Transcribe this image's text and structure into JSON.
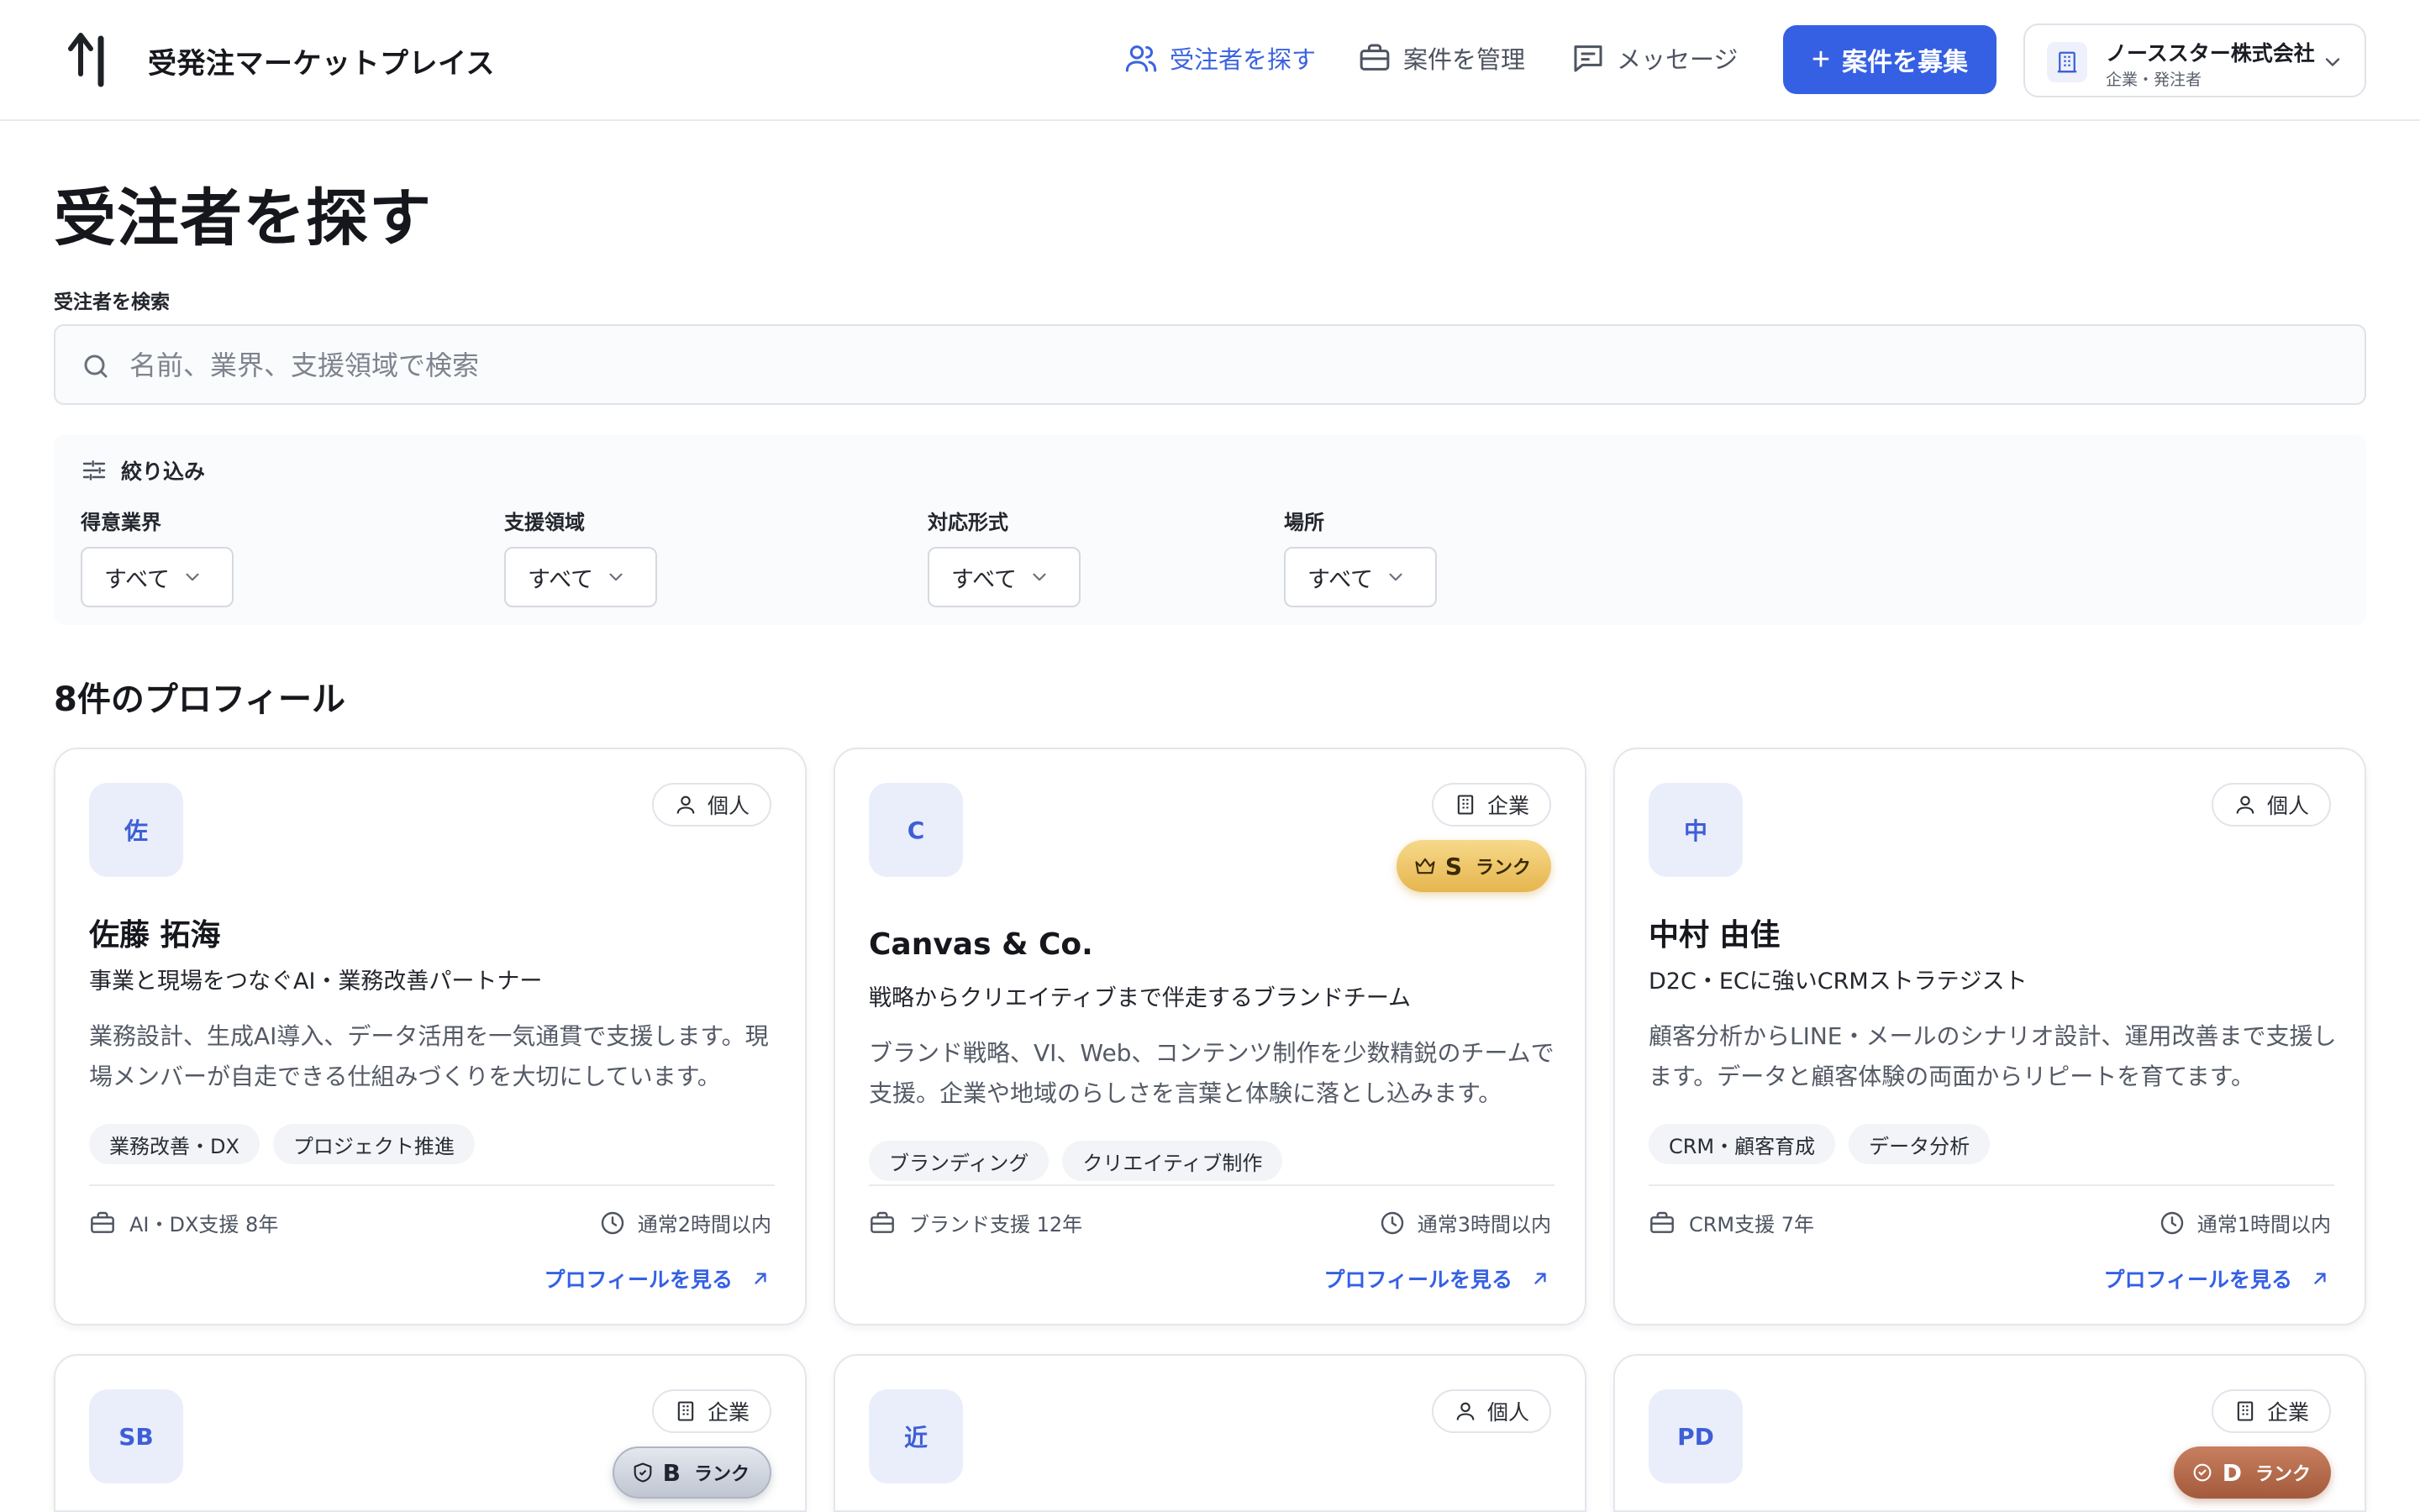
{
  "app": {
    "brand": "受発注マーケットプレイス",
    "logo_icon": "arrow-logo-icon"
  },
  "nav": [
    {
      "label": "受注者を探す",
      "icon": "users-icon",
      "active": true
    },
    {
      "label": "案件を管理",
      "icon": "briefcase-icon",
      "active": false
    },
    {
      "label": "メッセージ",
      "icon": "message-icon",
      "active": false
    }
  ],
  "cta": {
    "label": "案件を募集"
  },
  "account": {
    "name": "ノーススター株式会社",
    "role": "企業・発注者"
  },
  "page": {
    "title": "受注者を探す"
  },
  "search": {
    "label": "受注者を検索",
    "placeholder": "名前、業界、支援領域で検索",
    "value": ""
  },
  "filters": {
    "heading": "絞り込み",
    "groups": [
      {
        "label": "得意業界",
        "selected": "すべて"
      },
      {
        "label": "支援領域",
        "selected": "すべて"
      },
      {
        "label": "対応形式",
        "selected": "すべて"
      },
      {
        "label": "場所",
        "selected": "すべて"
      }
    ]
  },
  "results": {
    "count_text": "8件のプロフィール"
  },
  "link_label": "プロフィールを見る",
  "cards": [
    {
      "avatar": "佐",
      "type": "個人",
      "rank": "",
      "rank_suffix": "",
      "name": "佐藤 拓海",
      "tagline": "事業と現場をつなぐAI・業務改善パートナー",
      "desc": "業務設計、生成AI導入、データ活用を一気通貫で支援します。現場メンバーが自走できる仕組みづくりを大切にしています。",
      "chips": [
        "業務改善・DX",
        "プロジェクト推進"
      ],
      "experience": "AI・DX支援 8年",
      "response": "通常2時間以内"
    },
    {
      "avatar": "C",
      "type": "企業",
      "rank": "S",
      "rank_suffix": "ランク",
      "name": "Canvas & Co.",
      "tagline": "戦略からクリエイティブまで伴走するブランドチーム",
      "desc": "ブランド戦略、VI、Web、コンテンツ制作を少数精鋭のチームで支援。企業や地域のらしさを言葉と体験に落とし込みます。",
      "chips": [
        "ブランディング",
        "クリエイティブ制作"
      ],
      "experience": "ブランド支援 12年",
      "response": "通常3時間以内"
    },
    {
      "avatar": "中",
      "type": "個人",
      "rank": "",
      "rank_suffix": "",
      "name": "中村 由佳",
      "tagline": "D2C・ECに強いCRMストラテジスト",
      "desc": "顧客分析からLINE・メールのシナリオ設計、運用改善まで支援します。データと顧客体験の両面からリピートを育てます。",
      "chips": [
        "CRM・顧客育成",
        "データ分析"
      ],
      "experience": "CRM支援 7年",
      "response": "通常1時間以内"
    },
    {
      "avatar": "SB",
      "type": "企業",
      "rank": "B",
      "rank_suffix": "ランク"
    },
    {
      "avatar": "近",
      "type": "個人",
      "rank": "",
      "rank_suffix": ""
    },
    {
      "avatar": "PD",
      "type": "企業",
      "rank": "D",
      "rank_suffix": "ランク"
    }
  ],
  "colors": {
    "accent": "#3560e4",
    "rank_s": "#e6b54e",
    "rank_b": "#bfc6d2",
    "rank_d": "#a35a3c"
  }
}
